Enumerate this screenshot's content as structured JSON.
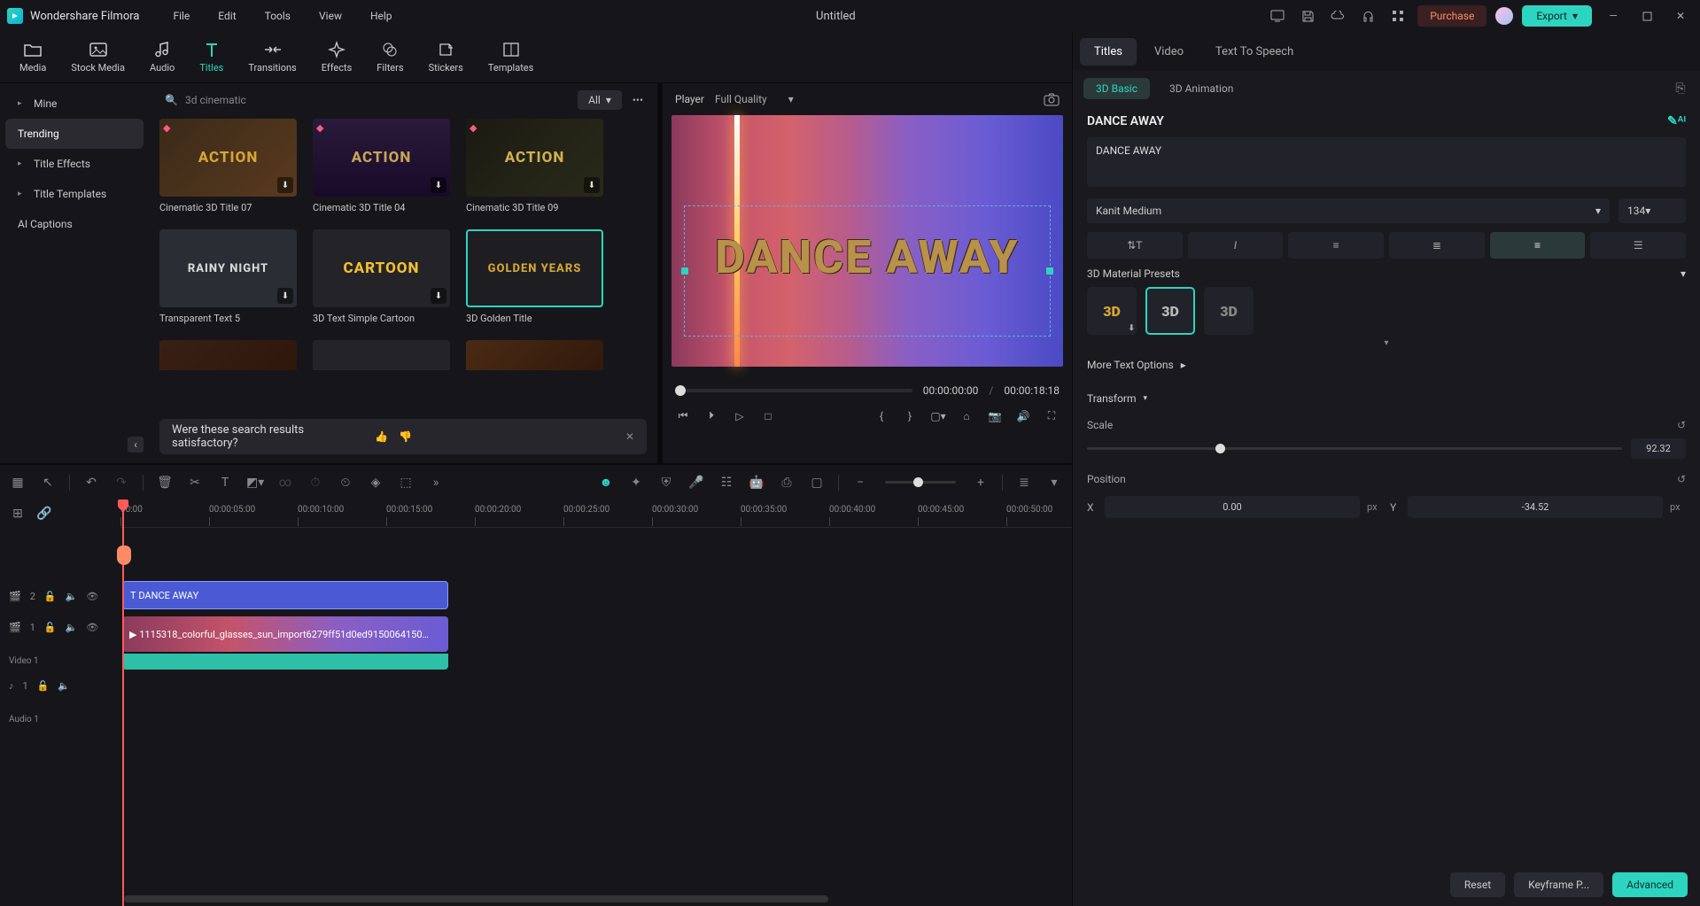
{
  "app_name": "Wondershare Filmora",
  "menu": [
    "File",
    "Edit",
    "Tools",
    "View",
    "Help"
  ],
  "doc_title": "Untitled",
  "purchase": "Purchase",
  "export": "Export",
  "media_tabs": [
    {
      "label": "Media"
    },
    {
      "label": "Stock Media"
    },
    {
      "label": "Audio"
    },
    {
      "label": "Titles",
      "active": true
    },
    {
      "label": "Transitions"
    },
    {
      "label": "Effects"
    },
    {
      "label": "Filters"
    },
    {
      "label": "Stickers"
    },
    {
      "label": "Templates"
    }
  ],
  "sidebar": [
    {
      "label": "Mine",
      "expandable": true
    },
    {
      "label": "Trending",
      "active": true
    },
    {
      "label": "Title Effects",
      "expandable": true
    },
    {
      "label": "Title Templates",
      "expandable": true
    },
    {
      "label": "AI Captions"
    }
  ],
  "search": {
    "query": "3d cinematic",
    "filter": "All"
  },
  "thumbs": [
    {
      "label": "Cinematic 3D Title 07",
      "text": "ACTION",
      "gem": true,
      "dl": true,
      "bg": "linear-gradient(135deg,#3a2a18,#5a3a1e)",
      "fg": "#d4a636"
    },
    {
      "label": "Cinematic 3D Title 04",
      "text": "ACTION",
      "gem": true,
      "dl": true,
      "bg": "linear-gradient(180deg,#2a1a3a,#1a0a2a)",
      "fg": "#c4a656"
    },
    {
      "label": "Cinematic 3D Title 09",
      "text": "ACTION",
      "gem": true,
      "dl": true,
      "bg": "linear-gradient(135deg,#1a1a12,#2a2a1a)",
      "fg": "#d0b050"
    },
    {
      "label": "Transparent Text 5",
      "text": "RAINY NIGHT",
      "dl": true,
      "bg": "#2a2e34",
      "fg": "#d8d8d8"
    },
    {
      "label": "3D Text Simple Cartoon",
      "text": "CARTOON",
      "dl": true,
      "bg": "#242428",
      "fg": "#f2c030"
    },
    {
      "label": "3D Golden Title",
      "text": "GOLDEN YEARS",
      "selected": true,
      "bg": "#1e1e22",
      "fg": "#d4a636"
    },
    {
      "label": "",
      "text": "",
      "bg": "linear-gradient(135deg,#3a2014,#2a1408)"
    },
    {
      "label": "",
      "text": "",
      "bg": "#242428"
    },
    {
      "label": "",
      "text": "",
      "bg": "linear-gradient(135deg,#4a2a14,#2a1408)"
    }
  ],
  "feedback": "Were these search results satisfactory?",
  "player": {
    "label": "Player",
    "quality": "Full Quality",
    "title_text": "DANCE AWAY",
    "current": "00:00:00:00",
    "duration": "00:00:18:18"
  },
  "ruler": [
    "00:00",
    "00:00:05:00",
    "00:00:10:00",
    "00:00:15:00",
    "00:00:20:00",
    "00:00:25:00",
    "00:00:30:00",
    "00:00:35:00",
    "00:00:40:00",
    "00:00:45:00",
    "00:00:50:00"
  ],
  "tracks": {
    "t2_badge": "2",
    "title_clip": "DANCE AWAY",
    "t1_badge": "1",
    "video_label": "Video 1",
    "video_clip": "1115318_colorful_glasses_sun_import6279ff51d0ed9150064150…",
    "a1_badge": "1",
    "audio_label": "Audio 1"
  },
  "rpanel": {
    "tabs": [
      "Titles",
      "Video",
      "Text To Speech"
    ],
    "sub": [
      "3D Basic",
      "3D Animation"
    ],
    "heading": "DANCE AWAY",
    "text_value": "DANCE AWAY",
    "font": "Kanit Medium",
    "size": "134",
    "presets_label": "3D Material Presets",
    "more": "More Text Options",
    "transform": "Transform",
    "scale_label": "Scale",
    "scale_val": "92.32",
    "pos_label": "Position",
    "pos_x": "0.00",
    "pos_y": "-34.52",
    "unit": "px",
    "reset": "Reset",
    "keyframe": "Keyframe P...",
    "advanced": "Advanced"
  }
}
